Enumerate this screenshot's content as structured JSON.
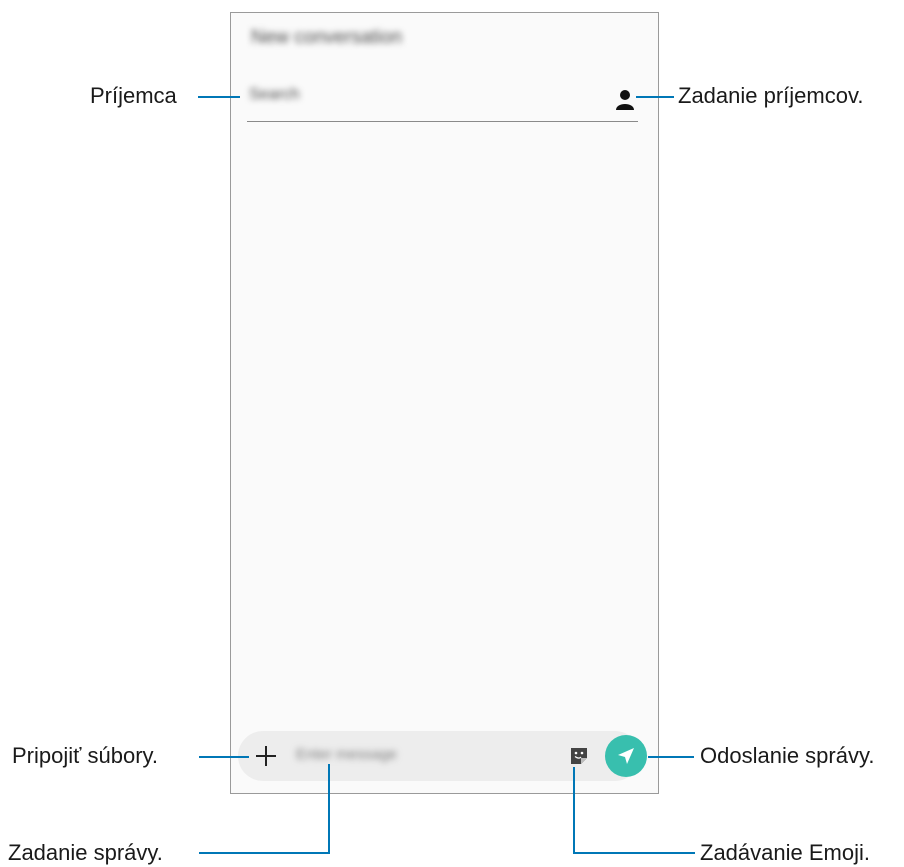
{
  "phone": {
    "title": "New conversation",
    "recipient_placeholder": "Search",
    "compose_placeholder": "Enter message"
  },
  "callouts": {
    "recipient": "Príjemca",
    "enter_recipients": "Zadanie príjemcov.",
    "attach_files": "Pripojiť súbory.",
    "send_message": "Odoslanie správy.",
    "enter_message": "Zadanie správy.",
    "enter_emoji": "Zadávanie Emoji."
  },
  "colors": {
    "callout_line": "#0077b6",
    "send_button": "#38bfae",
    "compose_bar": "#ededed"
  },
  "icons": [
    "contact-icon",
    "plus-icon",
    "emoji-sticker-icon",
    "send-arrow-icon"
  ]
}
